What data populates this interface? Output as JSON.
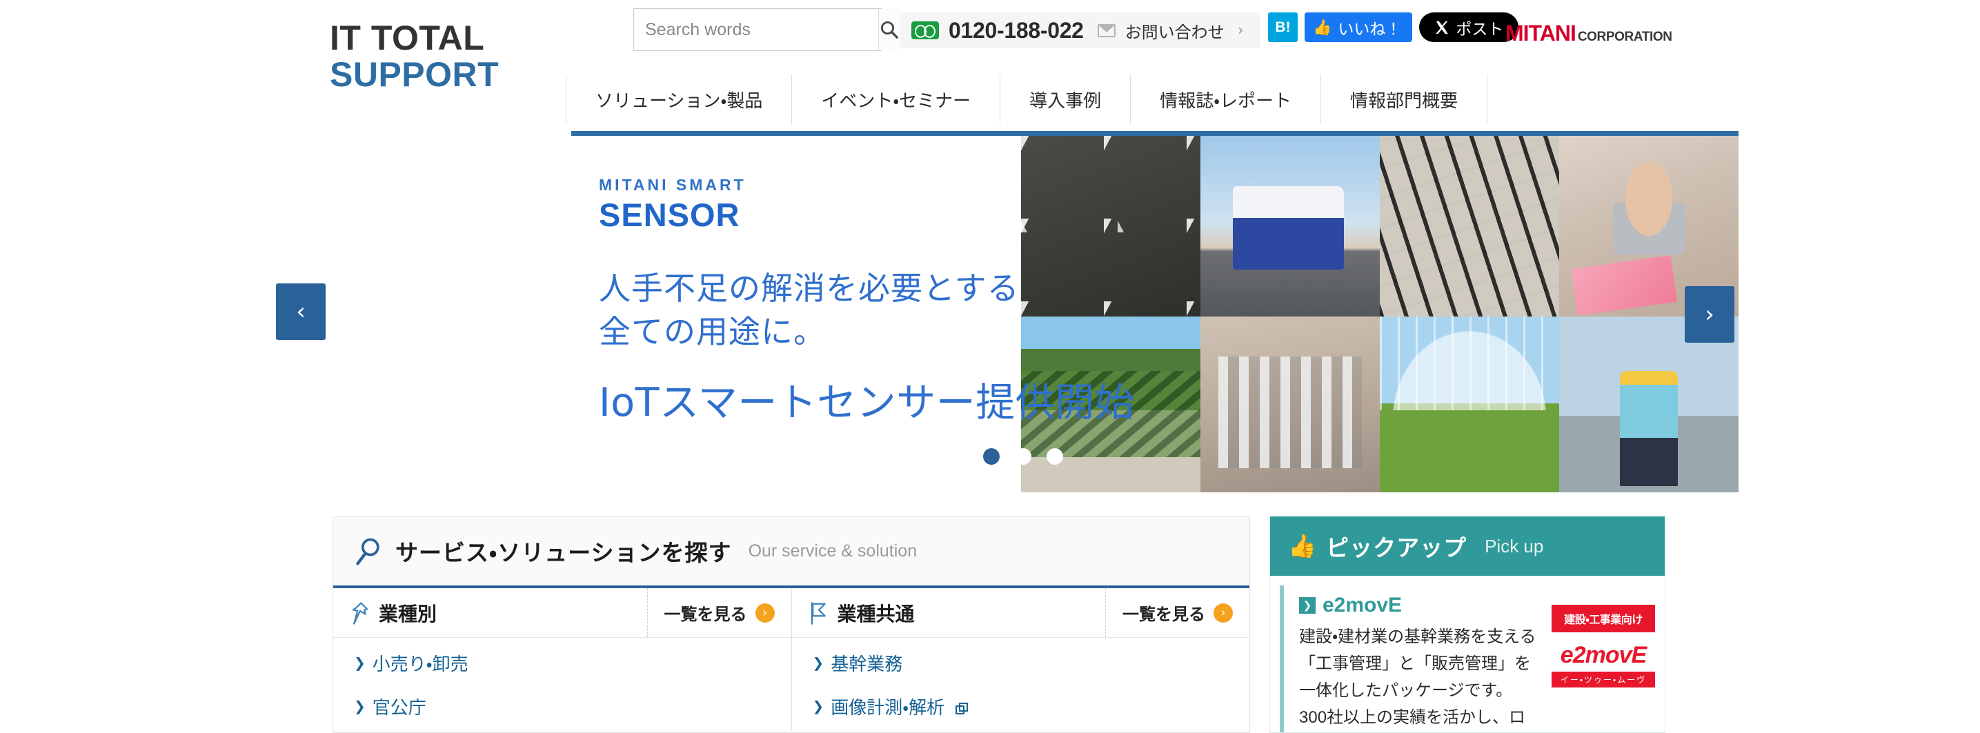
{
  "header": {
    "logo_line1": "IT TOTAL",
    "logo_line2": "SUPPORT",
    "search": {
      "placeholder": "Search words",
      "value": "",
      "icon": "search-icon"
    },
    "contact": {
      "freedial_icon": "freedial-icon",
      "phone": "0120-188-022",
      "mail_icon": "mail-icon",
      "label": "お問い合わせ",
      "arrow": "›"
    },
    "social": {
      "hatena_label": "B!",
      "facebook_label": "いいね！",
      "facebook_icon": "thumbs-up-icon",
      "x_label": "ポスト",
      "x_icon": "x-logo-icon"
    },
    "corporate_logo": {
      "name": "MITANI",
      "suffix": "CORPORATION"
    }
  },
  "nav": {
    "items": [
      {
        "label": "ソリューション・製品"
      },
      {
        "label": "イベント・セミナー"
      },
      {
        "label": "導入事例"
      },
      {
        "label": "情報誌・レポート"
      },
      {
        "label": "情報部門概要"
      }
    ]
  },
  "hero": {
    "brand_small": "MITANI SMART",
    "brand_large": "SENSOR",
    "copy_line1": "人手不足の解消を必要とする",
    "copy_line2": "全ての用途に。",
    "headline": "IoTスマートセンサー提供開始",
    "prev_label": "‹",
    "next_label": "›",
    "tiles": [
      {
        "name": "pipes-photo",
        "class": "t-pipes"
      },
      {
        "name": "truck-photo",
        "class": "t-truck"
      },
      {
        "name": "warehouse-racks-photo",
        "class": "t-racks"
      },
      {
        "name": "elderly-worker-photo",
        "class": "t-worker"
      },
      {
        "name": "quarry-photo",
        "class": "t-quarry"
      },
      {
        "name": "plant-facility-photo",
        "class": "t-plant"
      },
      {
        "name": "greenhouse-photo",
        "class": "t-green"
      },
      {
        "name": "schoolchild-photo",
        "class": "t-child"
      }
    ],
    "dots": [
      {
        "active": true
      },
      {
        "active": false
      },
      {
        "active": false
      }
    ]
  },
  "service": {
    "icon": "magnifier-icon",
    "title": "サービス・ソリューションを探す",
    "subtitle": "Our service & solution",
    "columns": [
      {
        "icon": "pin-icon",
        "title": "業種別",
        "more_label": "一覧を見る",
        "links": [
          {
            "label": "小売り・卸売",
            "external": false
          },
          {
            "label": "官公庁",
            "external": false
          }
        ]
      },
      {
        "icon": "flag-icon",
        "title": "業種共通",
        "more_label": "一覧を見る",
        "links": [
          {
            "label": "基幹業務",
            "external": false
          },
          {
            "label": "画像計測・解析",
            "external": true
          }
        ]
      }
    ]
  },
  "pickup": {
    "icon": "thumbs-up-icon",
    "title": "ピックアップ",
    "subtitle": "Pick up",
    "item": {
      "title": "e2movE",
      "description": "建設・建材業の基幹業務を支える「工事管理」と「販売管理」を一体化したパッケージです。300社以上の実績を活かし、ロ",
      "badge_top": "建設・工事業向け",
      "badge_logo": "e2movE",
      "badge_logo_sub": "イー・ツゥー・ムーヴ"
    }
  },
  "colors": {
    "brand_blue": "#2b6199",
    "hero_blue": "#2f6fce",
    "accent_orange": "#f5a21e",
    "teal": "#309a9a",
    "link_blue": "#156295",
    "red": "#e8172c"
  }
}
